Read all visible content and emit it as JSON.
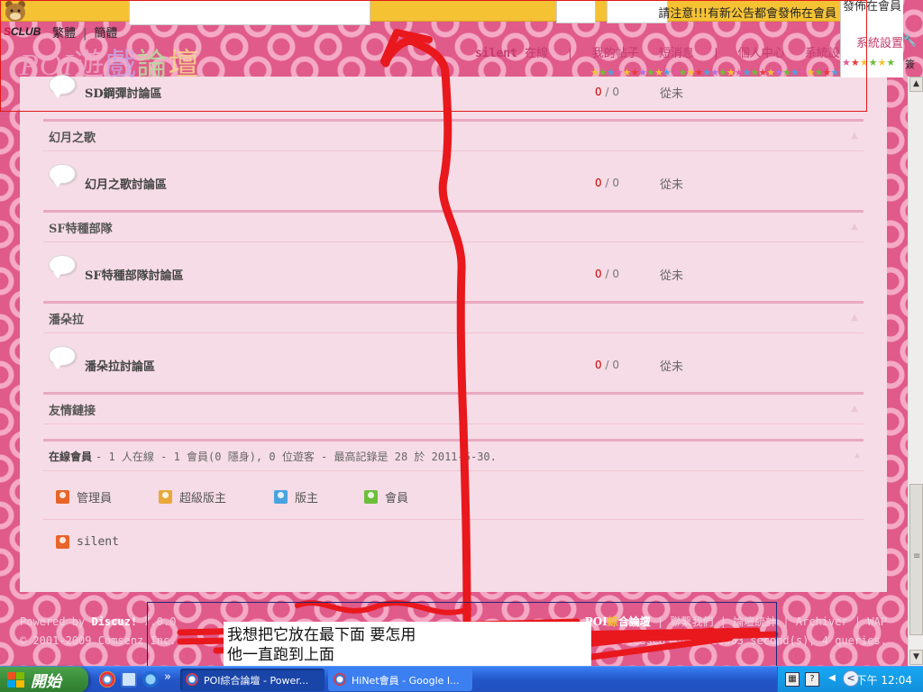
{
  "header": {
    "notice": "請注意!!!有新公告都會發佈在會員",
    "brand_prefix": "S",
    "brand_rest": "CLUB",
    "lang": {
      "traditional": "繁體",
      "simplified": "簡體",
      "sep": "|"
    },
    "logo": {
      "poi": "POI",
      "c1": "遊",
      "c2": "戲",
      "c3": "論",
      "c4": "壇"
    }
  },
  "nav": {
    "user": "silent",
    "online": "在線",
    "sep": "|",
    "my_posts": "我的帖子",
    "messages": "短消息",
    "profile": "個人中心",
    "settings": "系統設置"
  },
  "side_popup": {
    "title": "發佈在會員",
    "settings": "系統設置",
    "label": "簽"
  },
  "forums": {
    "rows": [
      {
        "name": "SD鋼彈討論區",
        "threads": "0",
        "slash": "/",
        "posts": "0",
        "last": "從未"
      },
      {
        "name": "幻月之歌討論區",
        "threads": "0",
        "slash": "/",
        "posts": "0",
        "last": "從未"
      },
      {
        "name": "SF特種部隊討論區",
        "threads": "0",
        "slash": "/",
        "posts": "0",
        "last": "從未"
      },
      {
        "name": "潘朵拉討論區",
        "threads": "0",
        "slash": "/",
        "posts": "0",
        "last": "從未"
      }
    ],
    "categories": [
      "幻月之歌",
      "SF特種部隊",
      "潘朵拉",
      "友情鏈接"
    ]
  },
  "online": {
    "title": "在線會員",
    "summary": "- 1 人在線 - 1 會員(0 隱身), 0 位遊客 - 最高記錄是 28 於 2011-5-30.",
    "legend": [
      {
        "label": "管理員",
        "color": "#e8652a"
      },
      {
        "label": "超級版主",
        "color": "#e8a93a"
      },
      {
        "label": "版主",
        "color": "#4aa3e0"
      },
      {
        "label": "會員",
        "color": "#6cbf3a"
      }
    ],
    "user": {
      "name": "silent",
      "color": "#e8652a"
    }
  },
  "footer": {
    "powered_prefix": "Powered by",
    "powered_brand": "Discuz!",
    "version": "7.0.0",
    "copyright": "© 2001-2009 Comsenz Inc.",
    "forum_title_a": "POI",
    "forum_title_b": "綜",
    "forum_title_c": "合論壇",
    "links": "| 聯繫我們 | 論壇統計 | Archiver | WAP",
    "process": "GMT+8, Processed in 0.010503 second(s), 4 queries."
  },
  "annotation": {
    "line1": "我想把它放在最下面 要怎用",
    "line2": "他一直跑到上面",
    "color": "#e8181c"
  },
  "taskbar": {
    "start": "開始",
    "more": "»",
    "task1": "POI綜合論壇 - Power...",
    "task2": "HiNet會員 - Google I...",
    "tray_q": "?",
    "tray_arrow": "<",
    "clock": "下午 12:04"
  },
  "scrollbar": {
    "up": "▲",
    "down": "▼"
  }
}
